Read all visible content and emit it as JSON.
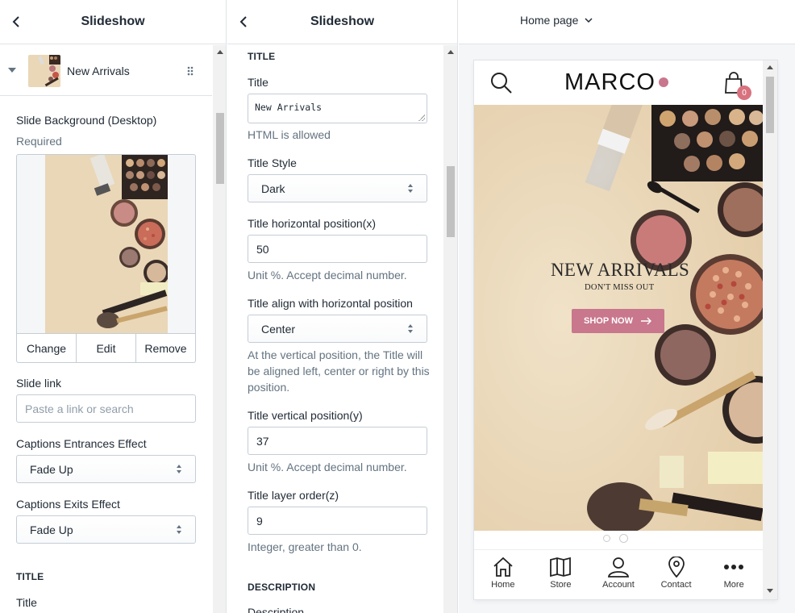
{
  "left_panel": {
    "title": "Slideshow",
    "slide_item": {
      "label": "New Arrivals"
    },
    "slide_background": {
      "label": "Slide Background (Desktop)",
      "required": "Required"
    },
    "image_actions": {
      "change": "Change",
      "edit": "Edit",
      "remove": "Remove"
    },
    "slide_link": {
      "label": "Slide link",
      "placeholder": "Paste a link or search"
    },
    "captions_entrances": {
      "label": "Captions Entrances Effect",
      "value": "Fade Up"
    },
    "captions_exits": {
      "label": "Captions Exits Effect",
      "value": "Fade Up"
    },
    "title_section": "TITLE",
    "title_label": "Title"
  },
  "mid_panel": {
    "title": "Slideshow",
    "section_title": "TITLE",
    "title_field": {
      "label": "Title",
      "value": "New Arrivals",
      "help": "HTML is allowed"
    },
    "title_style": {
      "label": "Title Style",
      "value": "Dark"
    },
    "title_hpos": {
      "label": "Title horizontal position(x)",
      "value": "50",
      "help": "Unit %. Accept decimal number."
    },
    "title_align": {
      "label": "Title align with horizontal position",
      "value": "Center",
      "help": "At the vertical position, the Title will be aligned left, center or right by this position."
    },
    "title_vpos": {
      "label": "Title vertical position(y)",
      "value": "37",
      "help": "Unit %. Accept decimal number."
    },
    "title_layer": {
      "label": "Title layer order(z)",
      "value": "9",
      "help": "Integer, greater than 0."
    },
    "description_section": "DESCRIPTION",
    "description_label": "Description"
  },
  "preview": {
    "page_selector": "Home page",
    "store": {
      "logo_text": "MARCO",
      "cart_count": "0",
      "hero_title": "NEW ARRIVALS",
      "hero_subtitle": "DON'T MISS OUT",
      "hero_button": "SHOP NOW",
      "button_color": "#c8778d",
      "badge_color": "#d9727f",
      "slide_count": 2,
      "active_slide": 2
    },
    "bottom_nav": [
      {
        "label": "Home",
        "icon": "home-icon"
      },
      {
        "label": "Store",
        "icon": "map-icon"
      },
      {
        "label": "Account",
        "icon": "user-icon"
      },
      {
        "label": "Contact",
        "icon": "location-pin-icon"
      },
      {
        "label": "More",
        "icon": "more-dots-icon"
      }
    ]
  }
}
